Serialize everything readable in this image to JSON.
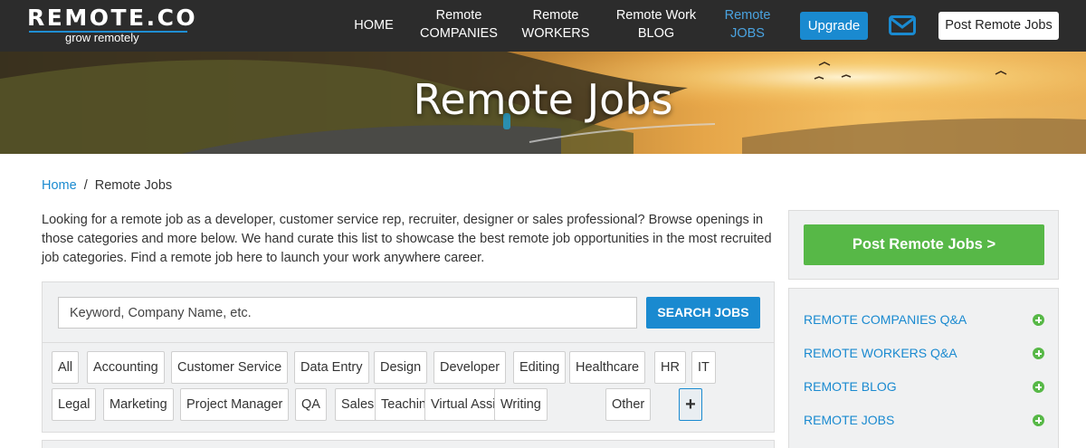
{
  "logo": {
    "wordmark": "REMOTE.CO",
    "tagline": "grow remotely"
  },
  "nav": {
    "home": "HOME",
    "companies_line1": "Remote",
    "companies_line2": "COMPANIES",
    "workers_line1": "Remote",
    "workers_line2": "WORKERS",
    "blog_line1": "Remote Work",
    "blog_line2": "BLOG",
    "jobs_line1": "Remote",
    "jobs_line2": "JOBS",
    "upgrade": "Upgrade",
    "mail_icon": "envelope-icon",
    "post_jobs": "Post Remote Jobs"
  },
  "hero": {
    "title": "Remote Jobs"
  },
  "breadcrumb": {
    "home": "Home",
    "separator": "/",
    "current": "Remote Jobs"
  },
  "intro": "Looking for a remote job as a developer, customer service rep, recruiter, designer or sales professional? Browse openings in those categories and more below. We hand curate this list to showcase the best remote job opportunities in the most recruited job categories. Find a remote job here to launch your work anywhere career.",
  "search": {
    "placeholder": "Keyword, Company Name, etc.",
    "button": "SEARCH JOBS",
    "tags_row1": [
      "All",
      "Accounting",
      "Customer Service",
      "Data Entry",
      "Design",
      "Developer",
      "Editing",
      "Healthcare",
      "HR",
      "IT"
    ],
    "tags_row2": [
      "Legal",
      "Marketing",
      "Project Manager",
      "QA",
      "Sales",
      "Teaching",
      "Virtual Assistant",
      "Writing",
      "Other"
    ],
    "more_label": "+"
  },
  "sidebar": {
    "post_button": "Post Remote Jobs >",
    "links": [
      "REMOTE COMPANIES Q&A",
      "REMOTE WORKERS Q&A",
      "REMOTE BLOG",
      "REMOTE JOBS"
    ],
    "link_icon": "plus-circle-icon"
  },
  "colors": {
    "header_bg": "#2c2c2c",
    "accent_blue": "#1a8ad0",
    "green": "#57b847",
    "panel_bg": "#f0f1f2"
  }
}
